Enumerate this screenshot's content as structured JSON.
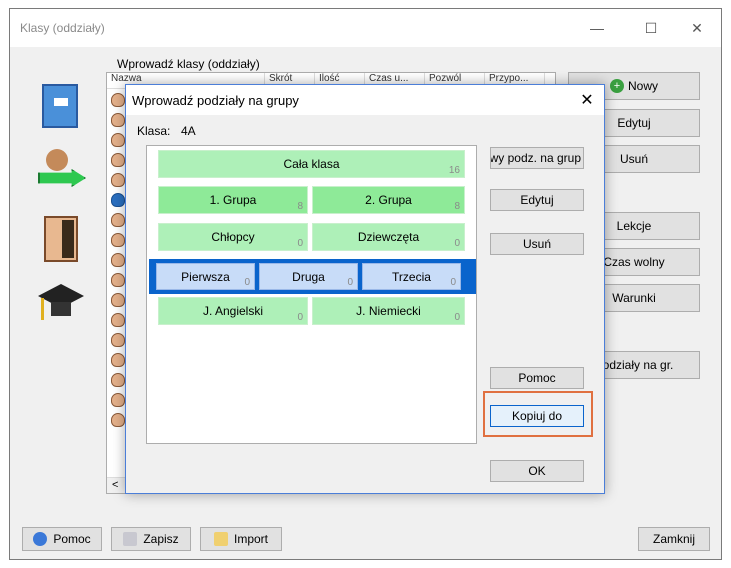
{
  "window": {
    "title": "Klasy (oddziały)",
    "minimize": "—",
    "maximize": "☐",
    "close": "✕"
  },
  "main": {
    "section_label": "Wprowadź klasy (oddziały)",
    "list_headers": [
      "Nazwa",
      "Skrót",
      "Ilość",
      "Czas u...",
      "Pozwól",
      "Przypo..."
    ],
    "right_buttons": [
      "Nowy",
      "Edytuj",
      "Usuń",
      "Lekcje",
      "Czas wolny",
      "Warunki",
      "Podziały na gr."
    ],
    "scroll_left": "<"
  },
  "footer": {
    "help": "Pomoc",
    "save": "Zapisz",
    "import": "Import",
    "close": "Zamknij"
  },
  "dialog": {
    "title": "Wprowadź podziały na grupy",
    "close": "✕",
    "klasa_label": "Klasa:",
    "klasa_value": "4A",
    "groups": {
      "whole": {
        "label": "Cała klasa",
        "count": "16"
      },
      "g1": {
        "label": "1. Grupa",
        "count": "8"
      },
      "g2": {
        "label": "2. Grupa",
        "count": "8"
      },
      "boys": {
        "label": "Chłopcy",
        "count": "0"
      },
      "girls": {
        "label": "Dziewczęta",
        "count": "0"
      },
      "first": {
        "label": "Pierwsza",
        "count": "0"
      },
      "second": {
        "label": "Druga",
        "count": "0"
      },
      "third": {
        "label": "Trzecia",
        "count": "0"
      },
      "english": {
        "label": "J. Angielski",
        "count": "0"
      },
      "german": {
        "label": "J. Niemiecki",
        "count": "0"
      }
    },
    "buttons": {
      "new": "Nowy podz. na grup",
      "edit": "Edytuj",
      "delete": "Usuń",
      "help": "Pomoc",
      "copy": "Kopiuj do",
      "ok": "OK"
    }
  }
}
